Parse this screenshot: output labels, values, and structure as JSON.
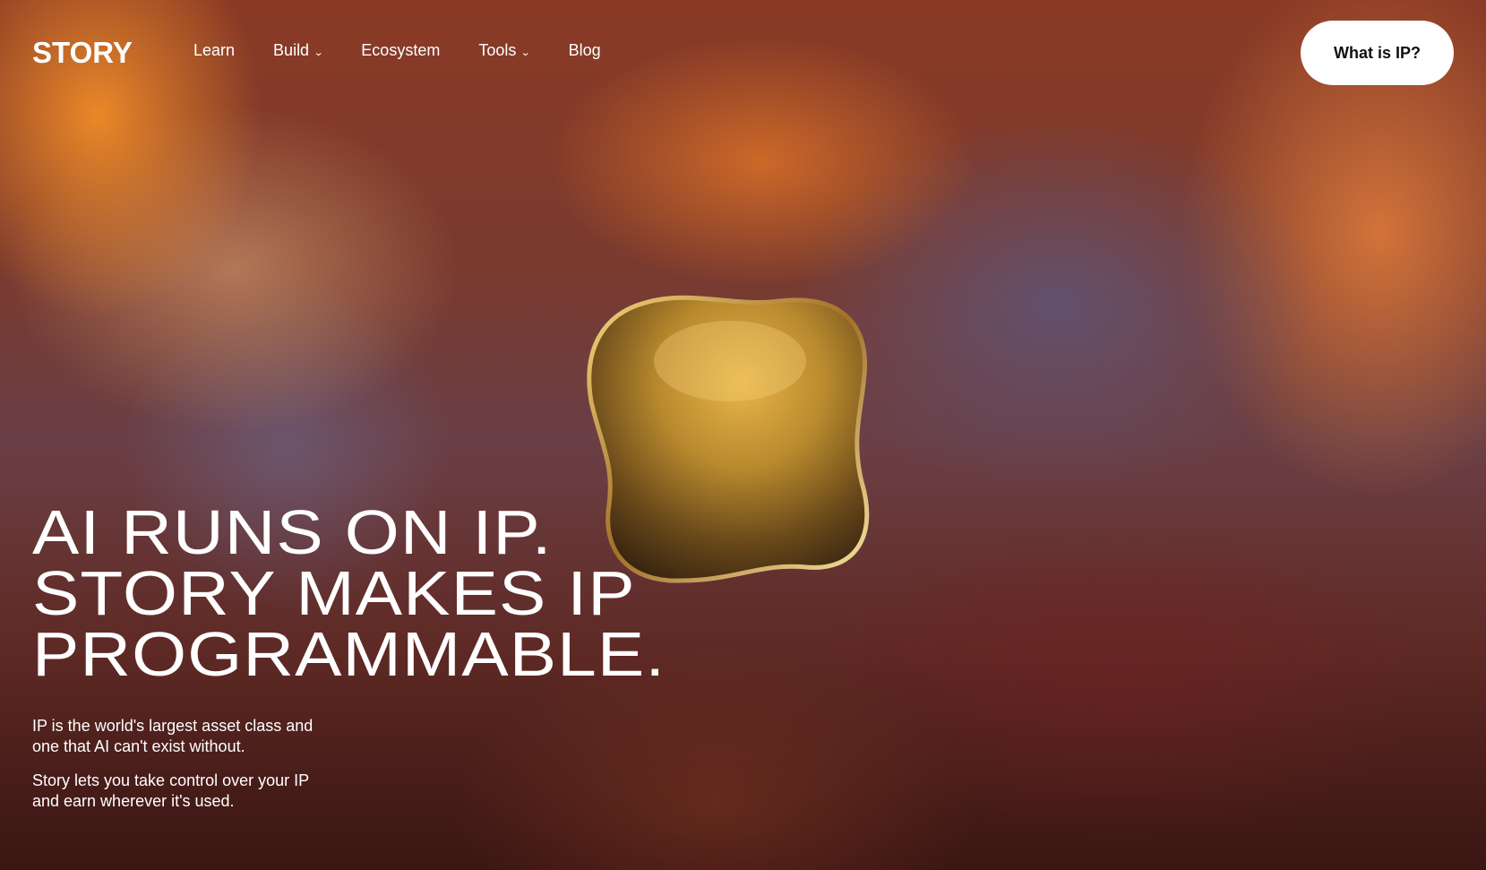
{
  "header": {
    "logo": "STORY",
    "nav": [
      {
        "label": "Learn",
        "has_dropdown": false
      },
      {
        "label": "Build",
        "has_dropdown": true
      },
      {
        "label": "Ecosystem",
        "has_dropdown": false
      },
      {
        "label": "Tools",
        "has_dropdown": true
      },
      {
        "label": "Blog",
        "has_dropdown": false
      }
    ],
    "cta_label": "What is IP?"
  },
  "hero": {
    "headline_lines": [
      "AI RUNS ON IP.",
      "STORY MAKES IP",
      "PROGRAMMABLE."
    ],
    "paragraphs": [
      "IP is the world's largest asset class and one that AI can't exist without.",
      "Story lets you take control over your IP and earn wherever it's used."
    ]
  },
  "icons": {
    "dropdown": "chevron-down-icon",
    "hero_art": "gold-blob-graphic"
  },
  "colors": {
    "cta_bg": "#ffffff",
    "cta_text": "#111111",
    "text": "#ffffff"
  }
}
